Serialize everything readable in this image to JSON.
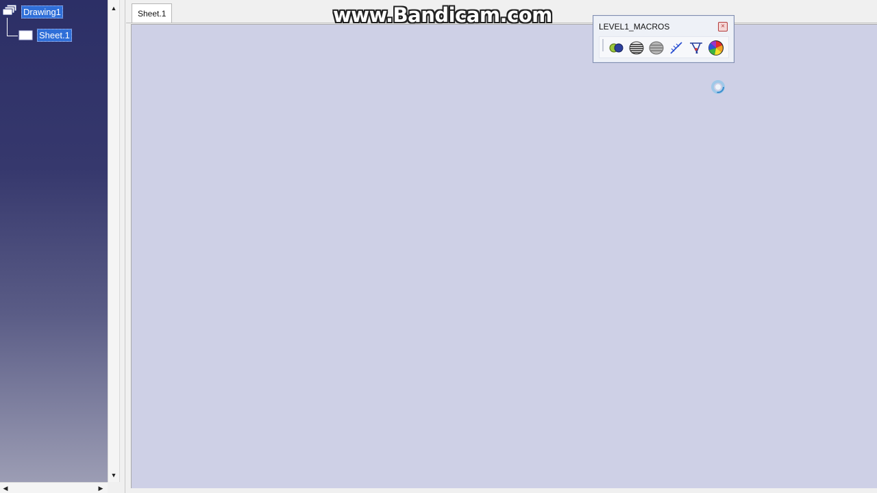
{
  "tree": {
    "root_label": "Drawing1",
    "child_label": "Sheet.1"
  },
  "tabs": [
    {
      "label": "Sheet.1"
    }
  ],
  "watermark": "www.Bandicam.com",
  "toolbar": {
    "title": "LEVEL1_MACROS",
    "close_glyph": "×",
    "buttons": [
      {
        "icon": "boolean-shapes-icon"
      },
      {
        "icon": "striped-sphere-icon"
      },
      {
        "icon": "gray-sphere-icon"
      },
      {
        "icon": "sketch-line-icon"
      },
      {
        "icon": "line-wizard-icon"
      },
      {
        "icon": "color-wheel-icon"
      }
    ]
  },
  "scroll_glyphs": {
    "up": "▲",
    "down": "▼",
    "left": "◀",
    "right": "▶"
  },
  "colors": {
    "canvas": "#ced0e6",
    "tree_selection": "#2f6fd8",
    "tree_background_top": "#2c2f66"
  }
}
